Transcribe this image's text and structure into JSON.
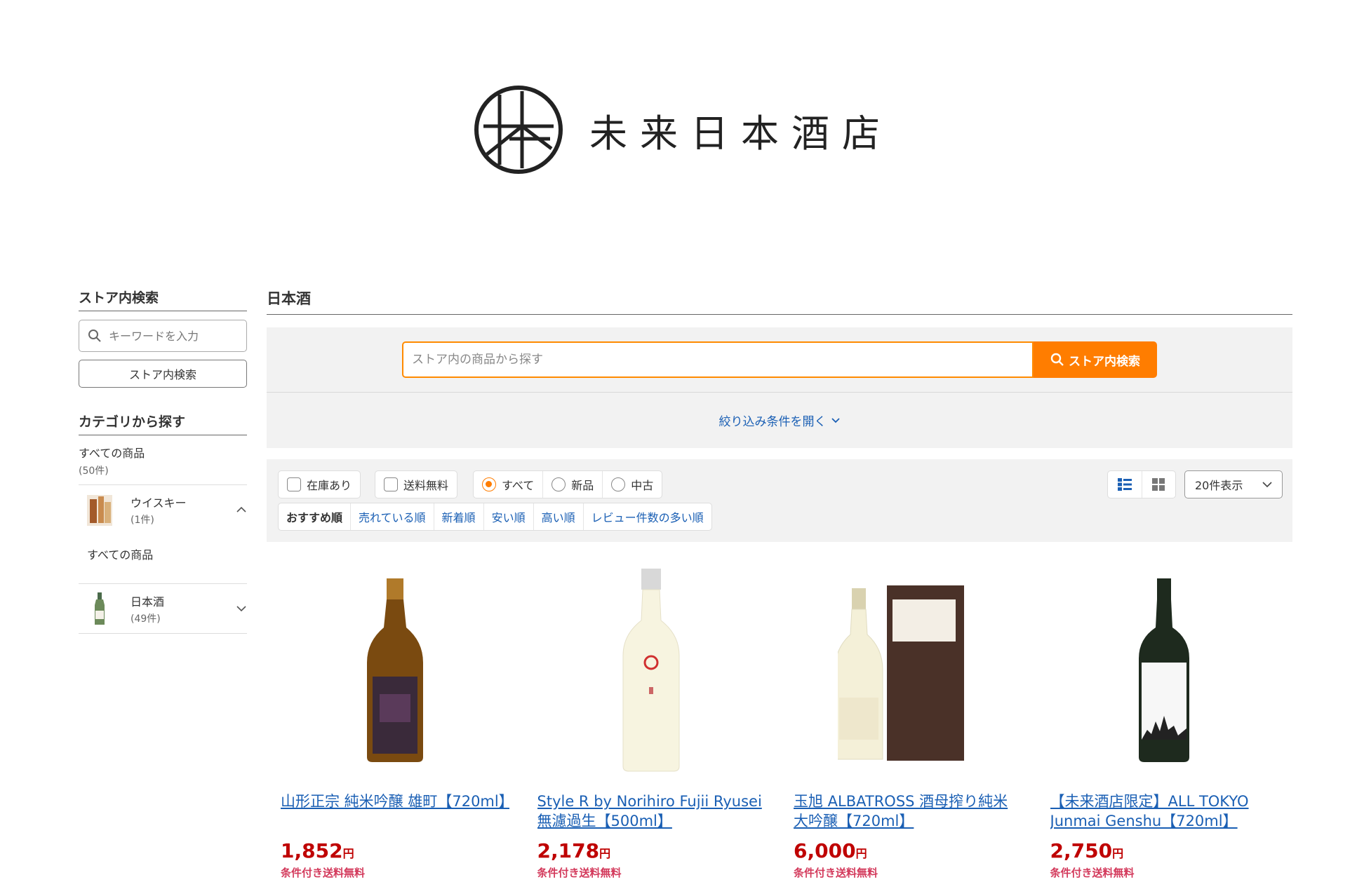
{
  "logo": {
    "name": "未来日本酒店",
    "icon": "shop-seal-logo"
  },
  "sidebar": {
    "search_heading": "ストア内検索",
    "search_placeholder": "キーワードを入力",
    "search_button": "ストア内検索",
    "category_heading": "カテゴリから探す",
    "all_products": {
      "name": "すべての商品",
      "count": "(50件)"
    },
    "categories": [
      {
        "name": "ウイスキー",
        "count": "(1件)",
        "expanded": true,
        "sub": "すべての商品"
      },
      {
        "name": "日本酒",
        "count": "(49件)",
        "expanded": false
      }
    ]
  },
  "main": {
    "title": "日本酒",
    "search_placeholder": "ストア内の商品から探す",
    "search_button": "ストア内検索",
    "filter_toggle": "絞り込み条件を開く",
    "filters": {
      "in_stock": "在庫あり",
      "free_shipping": "送料無料",
      "condition": [
        "すべて",
        "新品",
        "中古"
      ],
      "condition_selected": "すべて"
    },
    "sort": [
      "おすすめ順",
      "売れている順",
      "新着順",
      "安い順",
      "高い順",
      "レビュー件数の多い順"
    ],
    "sort_active": "おすすめ順",
    "per_page": "20件表示",
    "products": [
      {
        "name": "山形正宗 純米吟醸 雄町【720ml】",
        "price": "1,852",
        "yen": "円",
        "shipping": "条件付き送料無料"
      },
      {
        "name": "Style R by Norihiro Fujii Ryusei 無濾過生【500ml】",
        "price": "2,178",
        "yen": "円",
        "shipping": "条件付き送料無料"
      },
      {
        "name": "玉旭 ALBATROSS 酒母搾り純米大吟醸【720ml】",
        "price": "6,000",
        "yen": "円",
        "shipping": "条件付き送料無料"
      },
      {
        "name": "【未来酒店限定】ALL TOKYO Junmai Genshu【720ml】",
        "price": "2,750",
        "yen": "円",
        "shipping": "条件付き送料無料"
      }
    ]
  },
  "colors": {
    "accent": "#ff7d00",
    "link": "#1a5fb4",
    "price": "#bf0000",
    "shipping": "#d3395b"
  }
}
